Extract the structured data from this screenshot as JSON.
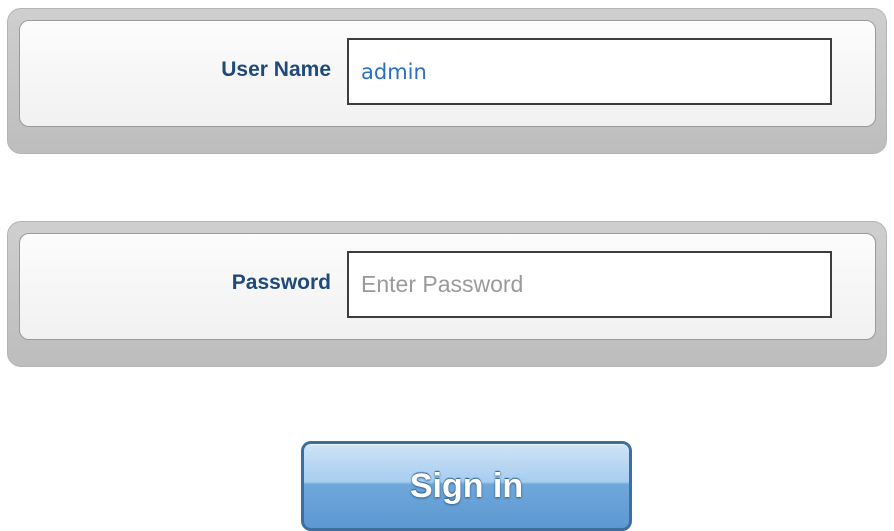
{
  "form": {
    "username": {
      "label": "User Name",
      "value": "admin",
      "placeholder": ""
    },
    "password": {
      "label": "Password",
      "value": "",
      "placeholder": "Enter Password"
    },
    "submit": {
      "label": "Sign in"
    }
  },
  "colors": {
    "label_text": "#1f4a7a",
    "input_text": "#2a6fc6",
    "placeholder_text": "#9a9a9a",
    "button_face": "#a7cdf0",
    "button_border": "#3d6f9e"
  }
}
